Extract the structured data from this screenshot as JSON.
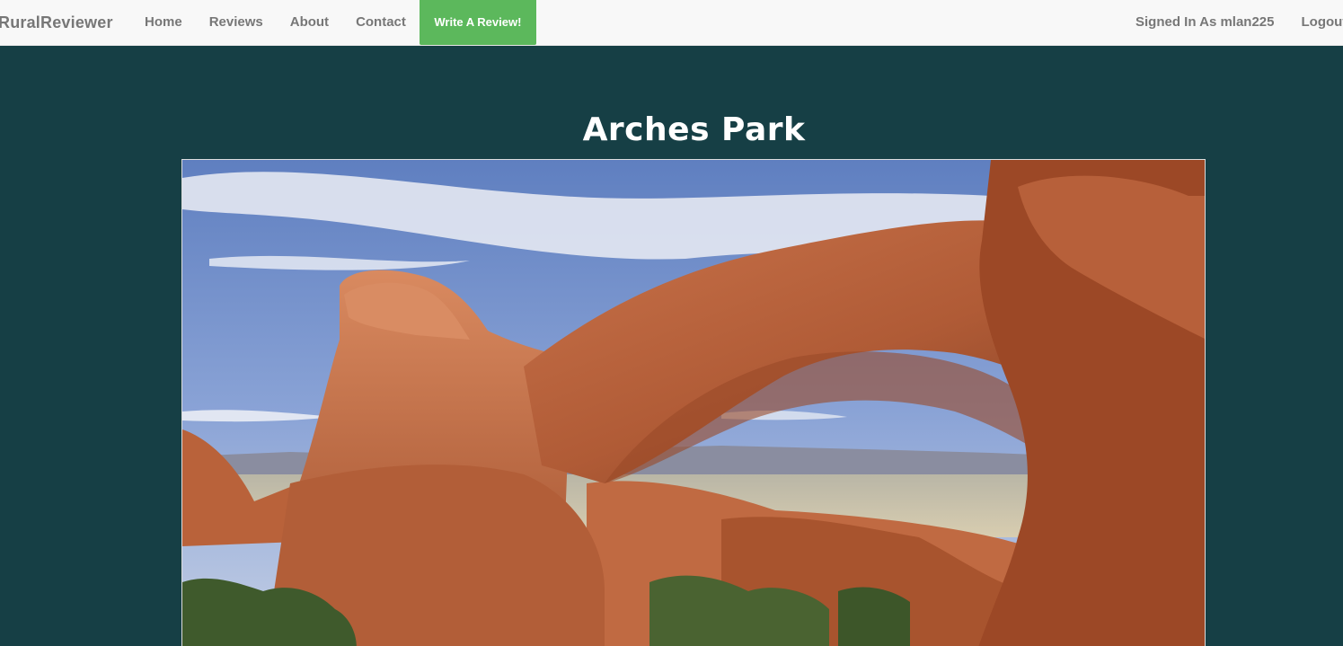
{
  "navbar": {
    "brand": "RuralReviewer",
    "links": [
      {
        "label": "Home"
      },
      {
        "label": "Reviews"
      },
      {
        "label": "About"
      },
      {
        "label": "Contact"
      }
    ],
    "cta_label": "Write A Review!",
    "signed_in": "Signed In As mlan225",
    "logout": "Logout"
  },
  "page": {
    "title": "Arches Park"
  },
  "hero_image": {
    "alt": "Double O Arch in Arches National Park",
    "icon": "photo-image"
  },
  "colors": {
    "background": "#163f45",
    "navbar": "#f8f8f8",
    "cta": "#5cb85c",
    "nav_text": "#777777"
  }
}
